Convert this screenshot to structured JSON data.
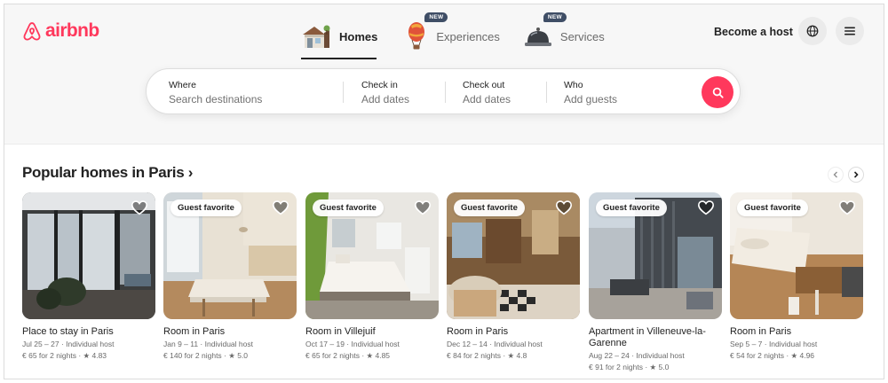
{
  "brand": {
    "name": "airbnb",
    "color": "#ff385c"
  },
  "nav": {
    "tabs": [
      {
        "label": "Homes",
        "icon": "house-icon",
        "active": true
      },
      {
        "label": "Experiences",
        "icon": "hot-air-balloon-icon",
        "badge": "NEW"
      },
      {
        "label": "Services",
        "icon": "service-bell-icon",
        "badge": "NEW"
      }
    ]
  },
  "header": {
    "host_link": "Become a host",
    "globe_icon": "globe-icon",
    "menu_icon": "hamburger-menu-icon"
  },
  "search": {
    "where": {
      "label": "Where",
      "placeholder": "Search destinations"
    },
    "checkin": {
      "label": "Check in",
      "placeholder": "Add dates"
    },
    "checkout": {
      "label": "Check out",
      "placeholder": "Add dates"
    },
    "who": {
      "label": "Who",
      "placeholder": "Add guests"
    },
    "button_icon": "search-icon"
  },
  "section": {
    "title": "Popular homes in Paris ›",
    "prev_icon": "chevron-left-icon",
    "next_icon": "chevron-right-icon"
  },
  "listings": [
    {
      "badge": "",
      "title": "Place to stay in Paris",
      "meta": "Jul 25 – 27 · Individual host",
      "price": "€ 65 for 2 nights · ★ 4.83"
    },
    {
      "badge": "Guest favorite",
      "title": "Room in Paris",
      "meta": "Jan 9 – 11 · Individual host",
      "price": "€ 140 for 2 nights · ★ 5.0"
    },
    {
      "badge": "Guest favorite",
      "title": "Room in Villejuif",
      "meta": "Oct 17 – 19 · Individual host",
      "price": "€ 65 for 2 nights · ★ 4.85"
    },
    {
      "badge": "Guest favorite",
      "title": "Room in Paris",
      "meta": "Dec 12 – 14 · Individual host",
      "price": "€ 84 for 2 nights · ★ 4.8"
    },
    {
      "badge": "Guest favorite",
      "title": "Apartment in Villeneuve-la-Garenne",
      "meta": "Aug 22 – 24 · Individual host",
      "price": "€ 91 for 2 nights · ★ 5.0"
    },
    {
      "badge": "Guest favorite",
      "title": "Room in Paris",
      "meta": "Sep 5 – 7 · Individual host",
      "price": "€ 54 for 2 nights · ★ 4.96"
    }
  ]
}
